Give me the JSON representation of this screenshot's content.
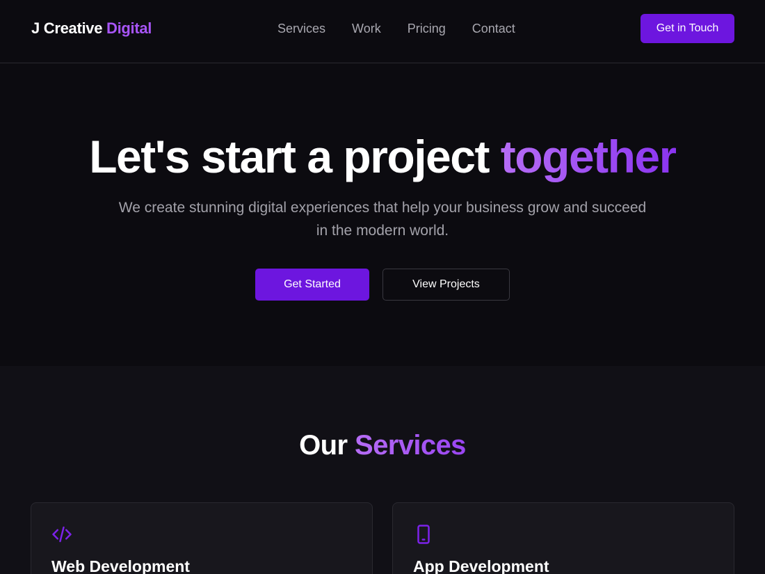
{
  "nav": {
    "brand_main": "J Creative",
    "brand_accent": "Digital",
    "links": [
      "Services",
      "Work",
      "Pricing",
      "Contact"
    ],
    "cta_label": "Get in Touch"
  },
  "hero": {
    "title_main": "Let's start a project",
    "title_accent": "together",
    "subtitle": "We create stunning digital experiences that help your business grow and succeed in the modern world.",
    "primary_label": "Get Started",
    "secondary_label": "View Projects"
  },
  "services": {
    "title_main": "Our",
    "title_accent": "Services",
    "cards": [
      {
        "icon": "code-icon",
        "title": "Web Development"
      },
      {
        "icon": "smartphone-icon",
        "title": "App Development"
      }
    ]
  },
  "colors": {
    "background": "#0c0b10",
    "section_background": "#111016",
    "accent": "#a855f7",
    "button": "#6d16df",
    "muted_text": "#a9a8b0"
  }
}
